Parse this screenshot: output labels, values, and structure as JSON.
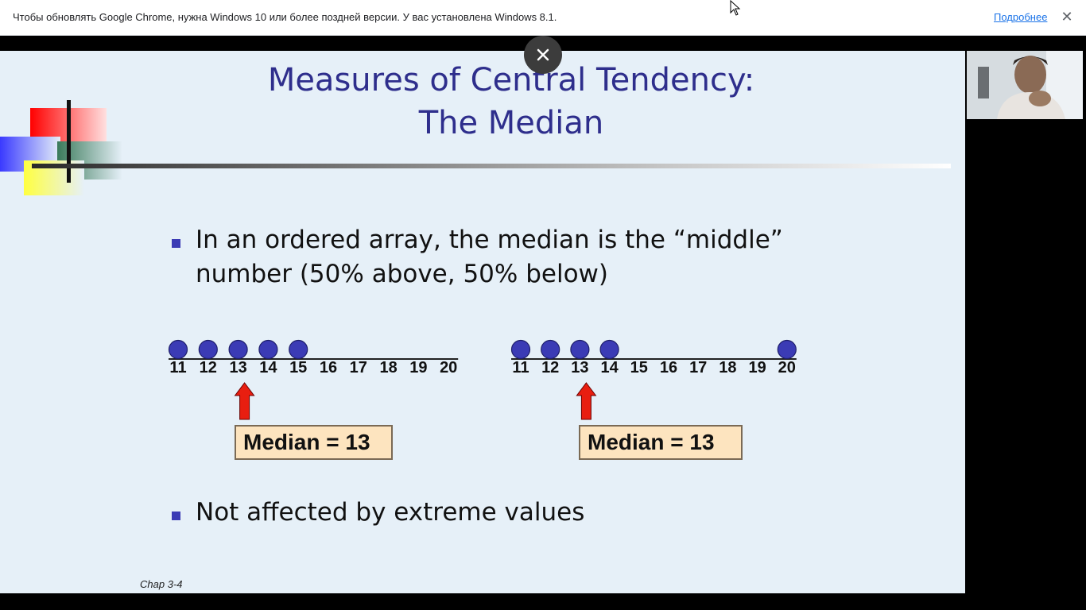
{
  "infobar": {
    "message": "Чтобы обновлять Google Chrome, нужна Windows 10 или более поздней версии. У вас установлена Windows 8.1.",
    "link": "Подробнее",
    "close": "✕"
  },
  "slide": {
    "close_glyph": "✕",
    "title_line1": "Measures of Central Tendency:",
    "title_line2": "The Median",
    "bullet1_line1": "In an ordered array, the median is the “middle”",
    "bullet1_line2": "number (50% above, 50% below)",
    "bullet2": "Not affected by extreme values",
    "footer": "Chap 3-4",
    "left_example": {
      "ticks": [
        "11",
        "12",
        "13",
        "14",
        "15",
        "16",
        "17",
        "18",
        "19",
        "20"
      ],
      "points": [
        11,
        12,
        13,
        14,
        15
      ],
      "median_label": "Median = 13",
      "median_value": 13
    },
    "right_example": {
      "ticks": [
        "11",
        "12",
        "13",
        "14",
        "15",
        "16",
        "17",
        "18",
        "19",
        "20"
      ],
      "points": [
        11,
        12,
        13,
        14,
        20
      ],
      "median_label": "Median = 13",
      "median_value": 13
    }
  },
  "colors": {
    "title": "#2e2e8c",
    "dot": "#3b3bb5",
    "arrow": "#e81e10",
    "box": "#fde4bf",
    "link": "#1a73e8"
  }
}
